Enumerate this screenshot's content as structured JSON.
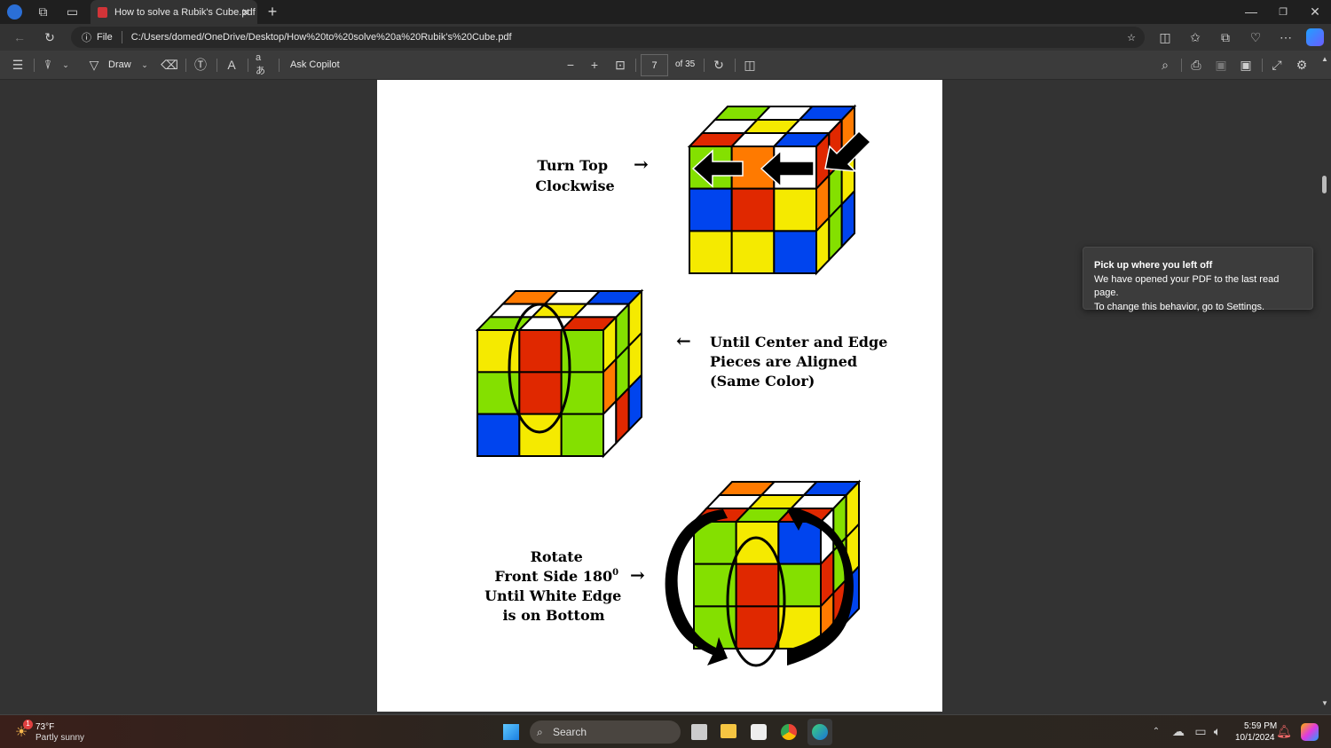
{
  "browser": {
    "tab_title": "How to solve a Rubik's Cube.pdf",
    "url_scheme": "File",
    "url": "C:/Users/domed/OneDrive/Desktop/How%20to%20solve%20a%20Rubik's%20Cube.pdf"
  },
  "toolbar": {
    "draw": "Draw",
    "ask_copilot": "Ask Copilot",
    "page": "7",
    "page_total": "of 35"
  },
  "tooltip": {
    "title": "Pick up where you left off",
    "line1": "We have opened your PDF to the last read page.",
    "line2": "To change this behavior, go to Settings."
  },
  "pdf": {
    "step1": [
      "Turn Top",
      "Clockwise"
    ],
    "step2": [
      "Until Center and Edge",
      "Pieces are Aligned",
      "(Same Color)"
    ],
    "step3": [
      "Rotate",
      "Front Side 180",
      "Until White Edge",
      "is on Bottom"
    ],
    "degree": "0",
    "arrow_right": "→",
    "arrow_left": "←",
    "colors": {
      "G": "#84e000",
      "W": "#ffffff",
      "B": "#0044ee",
      "Y": "#f5ea00",
      "R": "#e02800",
      "O": "#ff7a00"
    },
    "cubes": [
      {
        "front": [
          "GOW",
          "BRY",
          "YYB"
        ],
        "top": [
          "GWB",
          "WYW",
          "RWB"
        ],
        "right": [
          "RRO",
          "OGY",
          "YGB"
        ]
      },
      {
        "front": [
          "YRG",
          "GRG",
          "BYG"
        ],
        "top": [
          "OWB",
          "WYW",
          "GWR"
        ],
        "right": [
          "YGY",
          "OGY",
          "WRB"
        ]
      },
      {
        "front": [
          "GYB",
          "GRG",
          "GRY"
        ],
        "top": [
          "OWB",
          "WYW",
          "RGR"
        ],
        "right": [
          "WGY",
          "RGY",
          "ORB"
        ]
      }
    ]
  },
  "taskbar": {
    "temp": "73°F",
    "weather": "Partly sunny",
    "weather_badge": "1",
    "search": "Search",
    "time": "5:59 PM",
    "date": "10/1/2024"
  }
}
